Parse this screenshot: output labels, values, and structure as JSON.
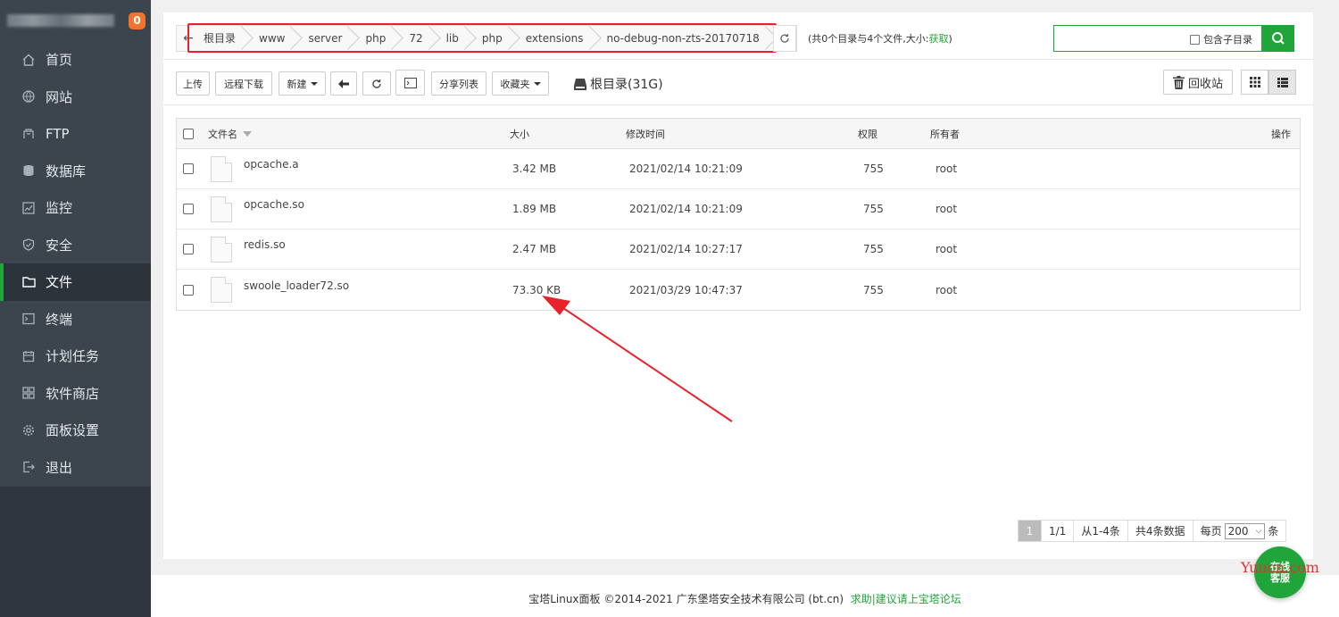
{
  "sidebar": {
    "badge": "0",
    "items": [
      {
        "label": "首页",
        "icon": "home-icon"
      },
      {
        "label": "网站",
        "icon": "globe-icon"
      },
      {
        "label": "FTP",
        "icon": "ftp-icon"
      },
      {
        "label": "数据库",
        "icon": "database-icon"
      },
      {
        "label": "监控",
        "icon": "monitor-icon"
      },
      {
        "label": "安全",
        "icon": "shield-icon"
      },
      {
        "label": "文件",
        "icon": "folder-icon",
        "active": true
      },
      {
        "label": "终端",
        "icon": "terminal-icon"
      },
      {
        "label": "计划任务",
        "icon": "calendar-icon"
      },
      {
        "label": "软件商店",
        "icon": "apps-icon"
      },
      {
        "label": "面板设置",
        "icon": "gear-icon"
      },
      {
        "label": "退出",
        "icon": "logout-icon"
      }
    ]
  },
  "path": {
    "crumbs": [
      "根目录",
      "www",
      "server",
      "php",
      "72",
      "lib",
      "php",
      "extensions",
      "no-debug-non-zts-20170718"
    ],
    "info_prefix": "(共0个目录与4个文件,大小:",
    "info_link": "获取",
    "info_suffix": ")"
  },
  "search": {
    "value": "",
    "placeholder": "",
    "include_sub": "包含子目录"
  },
  "toolbar": {
    "upload": "上传",
    "remote_download": "远程下载",
    "new": "新建",
    "share_list": "分享列表",
    "favorites": "收藏夹",
    "disk": "根目录(31G)",
    "recycle": "回收站"
  },
  "table": {
    "headers": {
      "name": "文件名",
      "size": "大小",
      "mtime": "修改时间",
      "perm": "权限",
      "owner": "所有者",
      "ops": "操作"
    },
    "rows": [
      {
        "name": "opcache.a",
        "size": "3.42 MB",
        "mtime": "2021/02/14 10:21:09",
        "perm": "755",
        "owner": "root"
      },
      {
        "name": "opcache.so",
        "size": "1.89 MB",
        "mtime": "2021/02/14 10:21:09",
        "perm": "755",
        "owner": "root"
      },
      {
        "name": "redis.so",
        "size": "2.47 MB",
        "mtime": "2021/02/14 10:27:17",
        "perm": "755",
        "owner": "root"
      },
      {
        "name": "swoole_loader72.so",
        "size": "73.30 KB",
        "mtime": "2021/03/29 10:47:37",
        "perm": "755",
        "owner": "root"
      }
    ]
  },
  "pager": {
    "current": "1",
    "pages": "1/1",
    "range": "从1-4条",
    "total": "共4条数据",
    "per_page_label": "每页",
    "per_page": "200",
    "unit": "条"
  },
  "footer": {
    "copyright": "宝塔Linux面板 ©2014-2021 广东堡塔安全技术有限公司 (bt.cn)",
    "link": "求助|建议请上宝塔论坛"
  },
  "support": {
    "label_line1": "在线",
    "label_line2": "客服"
  },
  "watermark": "Yuucn.com",
  "colors": {
    "accent": "#20a53a",
    "sidebar_bg": "#3c444d",
    "annotation": "#e8212b"
  }
}
